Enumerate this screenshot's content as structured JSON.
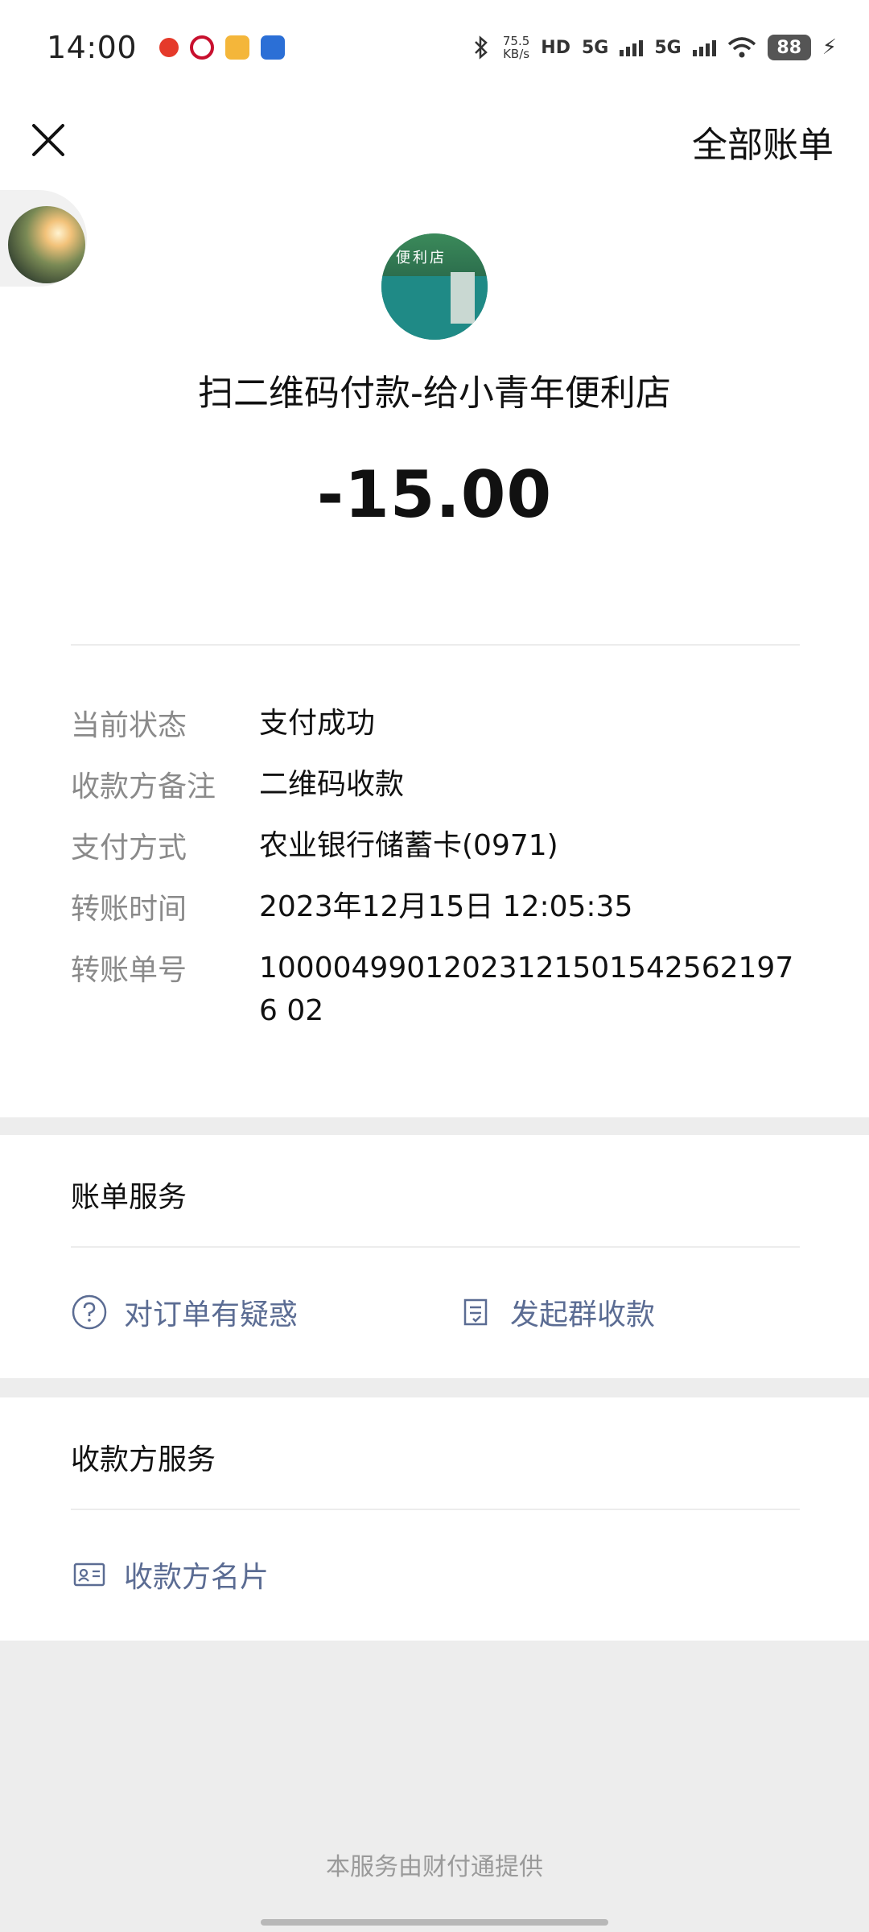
{
  "status_bar": {
    "time": "14:00",
    "speed_value": "75.5",
    "speed_unit": "KB/s",
    "hd_label": "HD",
    "sim1_label": "5G",
    "sim2_label": "5G",
    "battery": "88"
  },
  "header": {
    "close_icon": "close-icon",
    "all_bills_label": "全部账单"
  },
  "transaction": {
    "merchant_sign_text": "便利店",
    "title": "扫二维码付款-给小青年便利店",
    "amount": "-15.00"
  },
  "details": [
    {
      "label": "当前状态",
      "value": "支付成功"
    },
    {
      "label": "收款方备注",
      "value": "二维码收款"
    },
    {
      "label": "支付方式",
      "value": "农业银行储蓄卡(0971)"
    },
    {
      "label": "转账时间",
      "value": "2023年12月15日 12:05:35"
    },
    {
      "label": "转账单号",
      "value": "100004990120231215015425621976 02"
    }
  ],
  "bill_services": {
    "title": "账单服务",
    "items": [
      {
        "label": "对订单有疑惑",
        "icon": "question-circle-icon"
      },
      {
        "label": "发起群收款",
        "icon": "document-icon"
      }
    ]
  },
  "payee_services": {
    "title": "收款方服务",
    "items": [
      {
        "label": "收款方名片",
        "icon": "contact-card-icon"
      }
    ]
  },
  "footer": {
    "note": "本服务由财付通提供"
  },
  "colors": {
    "link": "#5b6c93",
    "label_gray": "#8a8a8a",
    "page_bg": "#ededed"
  }
}
